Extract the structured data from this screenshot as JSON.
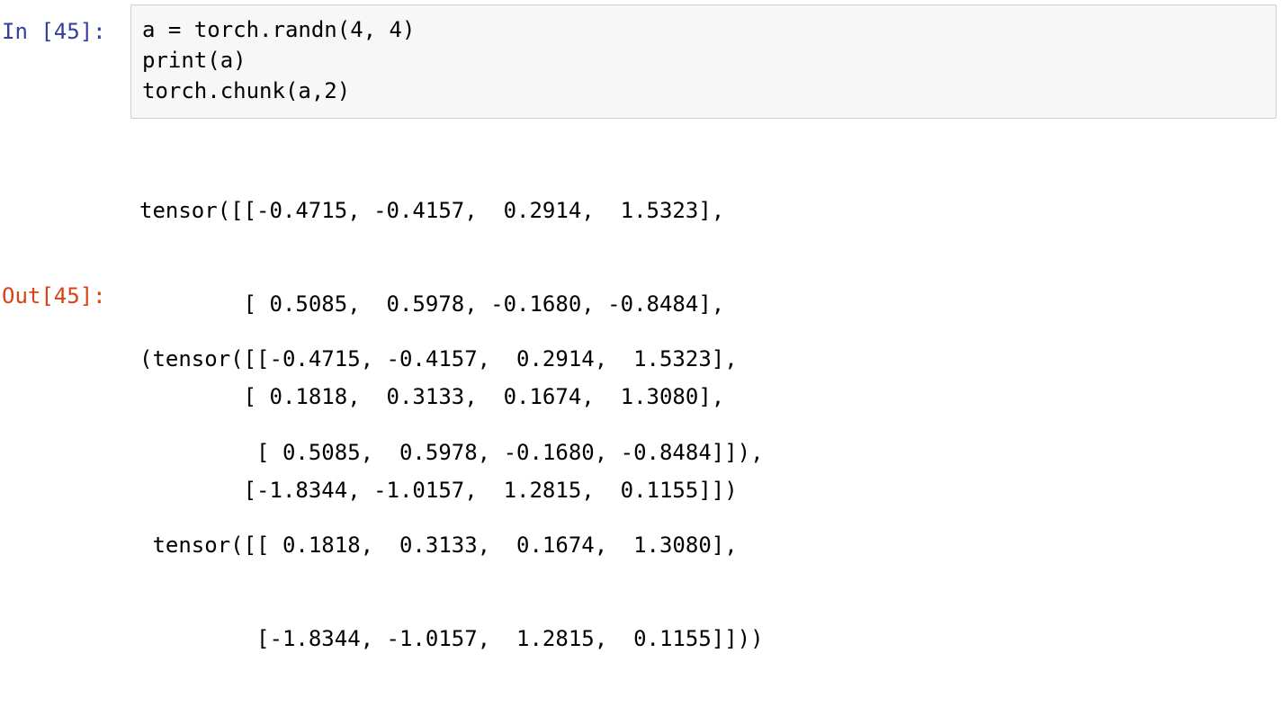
{
  "cell": {
    "in_prompt": "In [45]:",
    "out_prompt": "Out[45]:",
    "code_lines": [
      "a = torch.randn(4, 4)",
      "print(a)",
      "torch.chunk(a,2)"
    ],
    "stream_lines": [
      "tensor([[-0.4715, -0.4157,  0.2914,  1.5323],",
      "        [ 0.5085,  0.5978, -0.1680, -0.8484],",
      "        [ 0.1818,  0.3133,  0.1674,  1.3080],",
      "        [-1.8344, -1.0157,  1.2815,  0.1155]])"
    ],
    "result_lines": [
      "(tensor([[-0.4715, -0.4157,  0.2914,  1.5323],",
      "         [ 0.5085,  0.5978, -0.1680, -0.8484]]),",
      " tensor([[ 0.1818,  0.3133,  0.1674,  1.3080],",
      "         [-1.8344, -1.0157,  1.2815,  0.1155]]))"
    ]
  },
  "colors": {
    "in_prompt": "#303f9f",
    "out_prompt": "#d84315",
    "input_background": "#f7f7f7",
    "input_border": "#cfcfcf"
  }
}
